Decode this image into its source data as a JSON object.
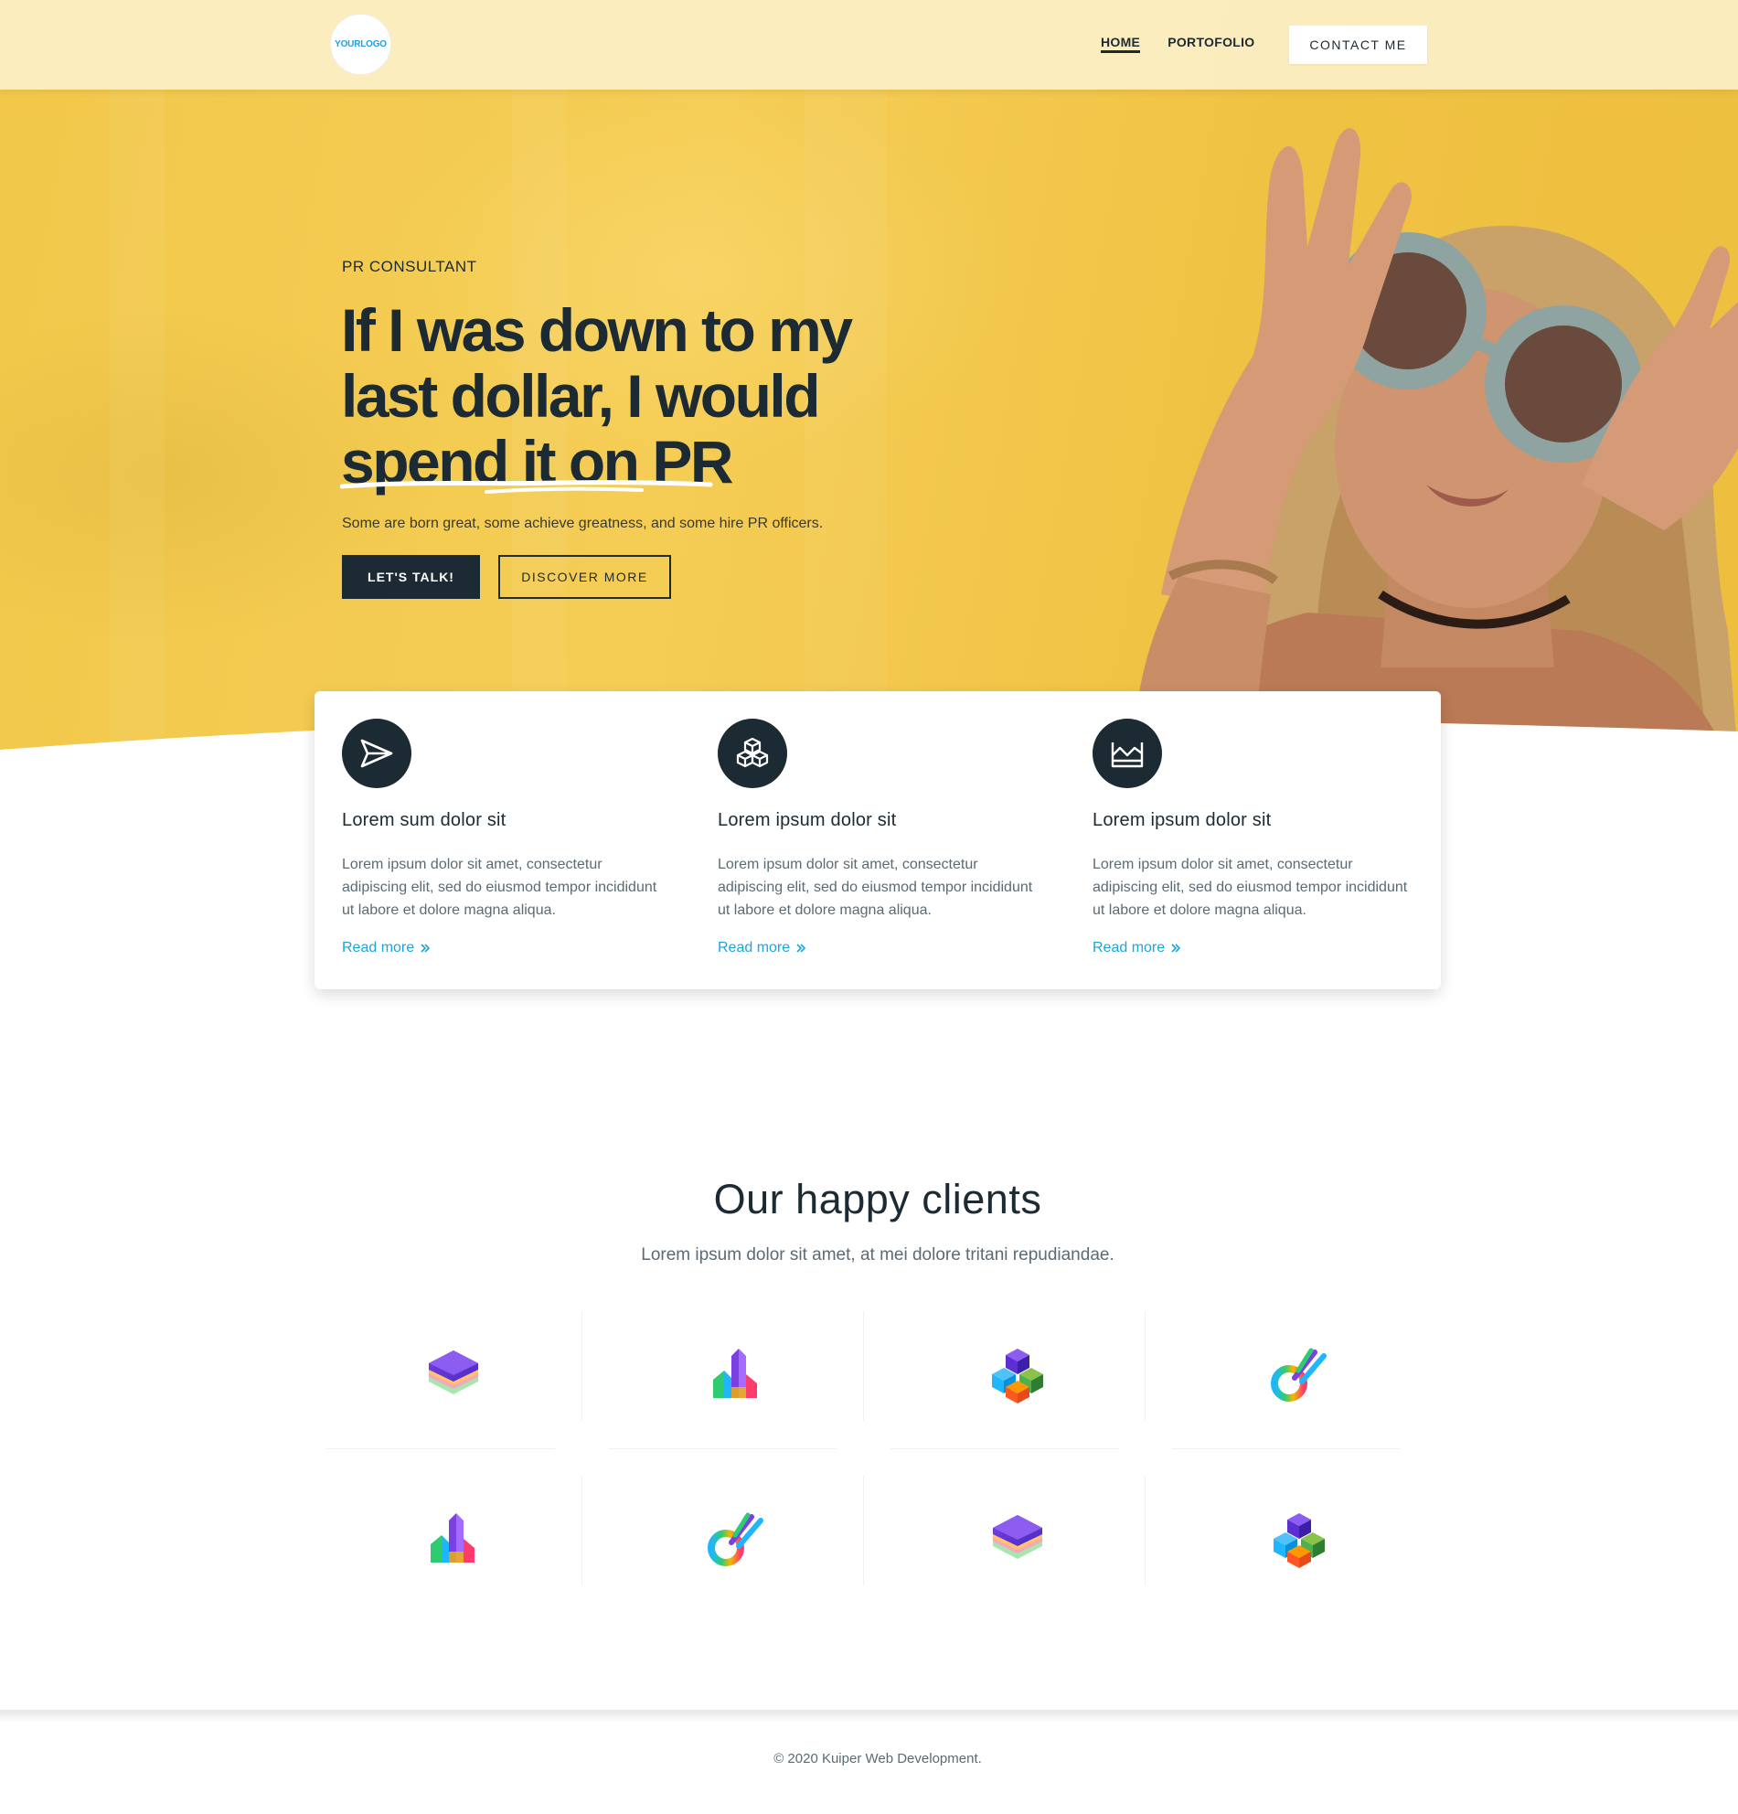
{
  "header": {
    "logo_text": "YOURLOGO",
    "nav": [
      {
        "label": "HOME",
        "active": true
      },
      {
        "label": "PORTOFOLIO",
        "active": false
      }
    ],
    "contact_label": "CONTACT ME"
  },
  "hero": {
    "eyebrow": "PR CONSULTANT",
    "headline_lines": [
      "If I was down to my",
      "last dollar, I would",
      "spend it on PR"
    ],
    "subline": "Some are born great, some achieve greatness, and some hire PR officers.",
    "primary_button": "LET'S TALK!",
    "secondary_button": "DISCOVER MORE"
  },
  "features": [
    {
      "icon": "paper-plane-icon",
      "title": "Lorem sum dolor sit",
      "text": "Lorem ipsum dolor sit amet, consectetur adipiscing elit, sed do eiusmod tempor incididunt ut labore et dolore magna aliqua.",
      "link": "Read more"
    },
    {
      "icon": "cubes-icon",
      "title": "Lorem ipsum dolor sit",
      "text": "Lorem ipsum dolor sit amet, consectetur adipiscing elit, sed do eiusmod tempor incididunt ut labore et dolore magna aliqua.",
      "link": "Read more"
    },
    {
      "icon": "area-chart-icon",
      "title": "Lorem ipsum dolor sit",
      "text": "Lorem ipsum dolor sit amet, consectetur adipiscing elit, sed do eiusmod tempor incididunt ut labore et dolore magna aliqua.",
      "link": "Read more"
    }
  ],
  "clients": {
    "title": "Our happy clients",
    "subtitle": "Lorem ipsum dolor sit amet, at mei dolore tritani repudiandae.",
    "logos": [
      "layers-logo-icon",
      "towers-logo-icon",
      "cubes-logo-icon",
      "swoosh-logo-icon",
      "towers-logo-icon",
      "swoosh-logo-icon",
      "layers-logo-icon",
      "cubes-logo-icon"
    ]
  },
  "footer": {
    "copyright": "© 2020 Kuiper Web Development."
  },
  "colors": {
    "dark": "#1c2a33",
    "accent": "#1ba6d9",
    "hero_yellow": "#f2c84a"
  }
}
